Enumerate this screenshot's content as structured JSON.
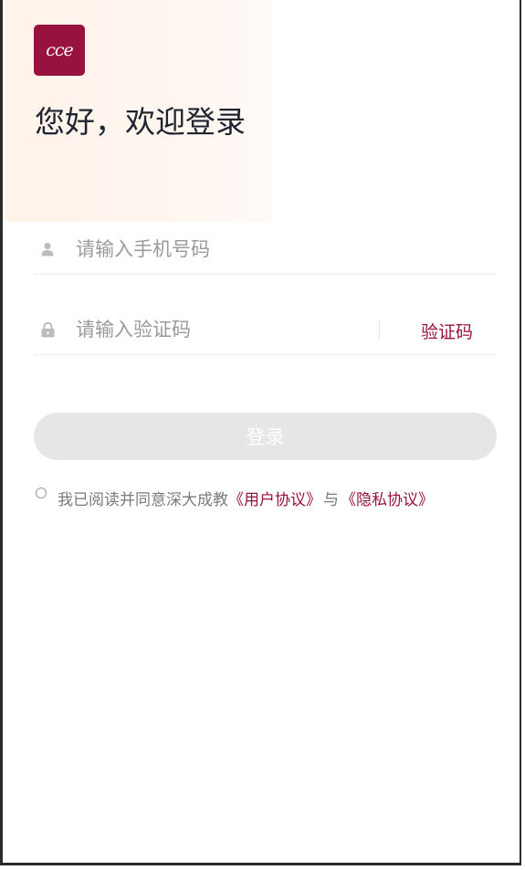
{
  "brand": {
    "logo_text": "cce",
    "accent_color": "#98123f"
  },
  "greeting": "您好，欢迎登录",
  "phone_field": {
    "icon": "user-icon",
    "placeholder": "请输入手机号码",
    "value": ""
  },
  "code_field": {
    "icon": "lock-icon",
    "placeholder": "请输入验证码",
    "value": "",
    "get_code_label": "验证码"
  },
  "login_button": {
    "label": "登录",
    "state": "disabled"
  },
  "agreement": {
    "checked": false,
    "prefix": "我已阅读并同意深大成教",
    "user_agreement": "《用户协议》",
    "conjunction": "与",
    "privacy_policy": "《隐私协议》"
  }
}
